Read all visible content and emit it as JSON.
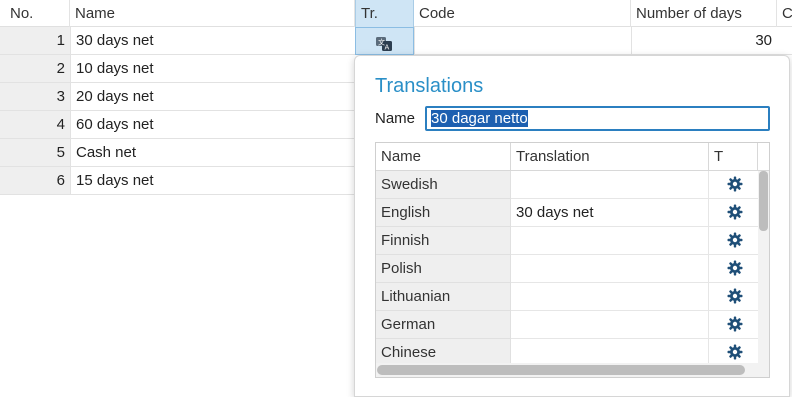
{
  "grid": {
    "columns": {
      "no": "No.",
      "name": "Name",
      "tr": "Tr.",
      "code": "Code",
      "days": "Number of days",
      "cut": "C"
    },
    "rows": [
      {
        "no": "1",
        "name": "30 days net",
        "days": "30"
      },
      {
        "no": "2",
        "name": "10 days net"
      },
      {
        "no": "3",
        "name": "20 days net"
      },
      {
        "no": "4",
        "name": "60 days net"
      },
      {
        "no": "5",
        "name": "Cash net"
      },
      {
        "no": "6",
        "name": "15 days net"
      }
    ]
  },
  "translations_popup": {
    "title": "Translations",
    "name_label": "Name",
    "name_value": "30 dagar netto",
    "table": {
      "columns": {
        "name": "Name",
        "translation": "Translation",
        "t": "T"
      },
      "rows": [
        {
          "name": "Swedish",
          "translation": ""
        },
        {
          "name": "English",
          "translation": "30 days net"
        },
        {
          "name": "Finnish",
          "translation": ""
        },
        {
          "name": "Polish",
          "translation": ""
        },
        {
          "name": "Lithuanian",
          "translation": ""
        },
        {
          "name": "German",
          "translation": ""
        },
        {
          "name": "Chinese",
          "translation": ""
        }
      ]
    }
  },
  "colors": {
    "accent": "#2a8fc7",
    "selection": "#cfe5f5",
    "gear": "#1f4f78"
  },
  "icons": {
    "translate": "translate-icon",
    "settings": "gear-icon"
  }
}
